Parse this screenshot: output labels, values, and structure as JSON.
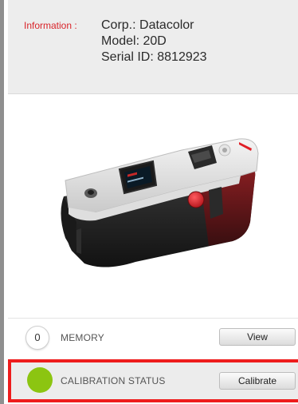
{
  "info": {
    "label": "Information :",
    "corp": "Corp.: Datacolor",
    "model": "Model: 20D",
    "serial": "Serial ID: 8812923"
  },
  "memory": {
    "count": "0",
    "label": "MEMORY",
    "view_label": "View"
  },
  "calibration": {
    "status_color": "#8cc511",
    "label": "CALIBRATION STATUS",
    "calibrate_label": "Calibrate"
  },
  "colors": {
    "accent_red": "#d9242a",
    "highlight_border": "#ee1c1c",
    "device_red": "#e01f26"
  }
}
